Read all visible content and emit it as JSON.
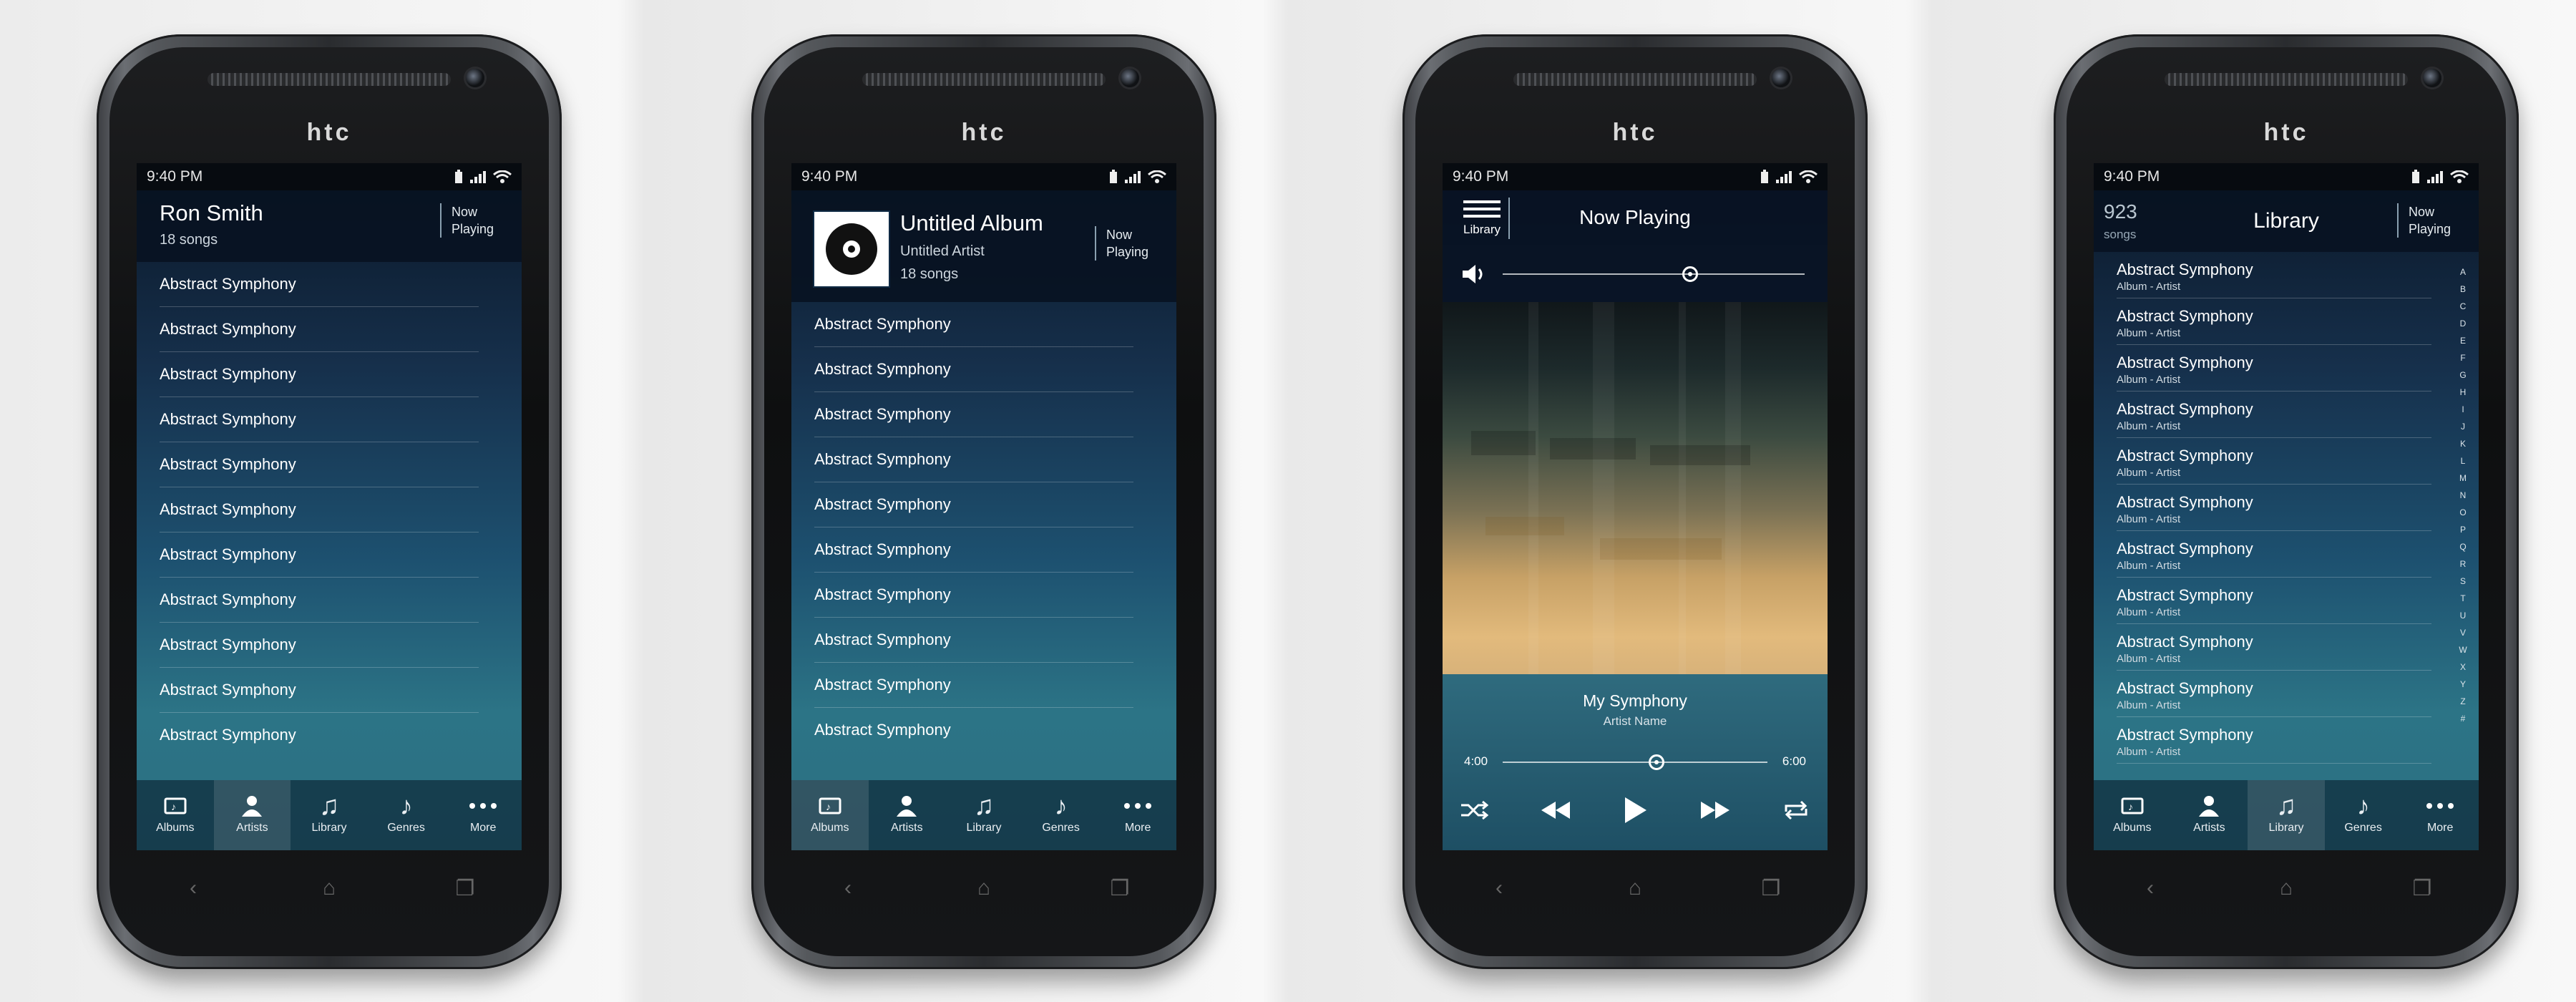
{
  "brand": "htc",
  "status_time": "9:40 PM",
  "tabs": [
    "Albums",
    "Artists",
    "Library",
    "Genres",
    "More"
  ],
  "artist_screen": {
    "title": "Ron Smith",
    "subtitle": "18 songs",
    "now_playing": [
      "Now",
      "Playing"
    ],
    "songs": [
      "Abstract Symphony",
      "Abstract Symphony",
      "Abstract Symphony",
      "Abstract Symphony",
      "Abstract Symphony",
      "Abstract Symphony",
      "Abstract Symphony",
      "Abstract Symphony",
      "Abstract Symphony",
      "Abstract Symphony",
      "Abstract Symphony"
    ],
    "active_tab": "Artists"
  },
  "album_screen": {
    "title": "Untitled Album",
    "artist": "Untitled Artist",
    "count": "18 songs",
    "now_playing": [
      "Now",
      "Playing"
    ],
    "songs": [
      "Abstract Symphony",
      "Abstract Symphony",
      "Abstract Symphony",
      "Abstract Symphony",
      "Abstract Symphony",
      "Abstract Symphony",
      "Abstract Symphony",
      "Abstract Symphony",
      "Abstract Symphony",
      "Abstract Symphony"
    ],
    "active_tab": "Albums"
  },
  "now_playing_screen": {
    "title": "Now Playing",
    "library_label": "Library",
    "song": "My Symphony",
    "artist": "Artist Name",
    "time_elapsed": "4:00",
    "time_total": "6:00",
    "volume_level": 0.62,
    "progress": 0.58
  },
  "library_screen": {
    "count": "923",
    "count_label": "songs",
    "title": "Library",
    "now_playing": [
      "Now",
      "Playing"
    ],
    "items": [
      {
        "title": "Abstract Symphony",
        "sub": "Album - Artist"
      },
      {
        "title": "Abstract Symphony",
        "sub": "Album - Artist"
      },
      {
        "title": "Abstract Symphony",
        "sub": "Album - Artist"
      },
      {
        "title": "Abstract Symphony",
        "sub": "Album - Artist"
      },
      {
        "title": "Abstract Symphony",
        "sub": "Album - Artist"
      },
      {
        "title": "Abstract Symphony",
        "sub": "Album - Artist"
      },
      {
        "title": "Abstract Symphony",
        "sub": "Album - Artist"
      },
      {
        "title": "Abstract Symphony",
        "sub": "Album - Artist"
      },
      {
        "title": "Abstract Symphony",
        "sub": "Album - Artist"
      },
      {
        "title": "Abstract Symphony",
        "sub": "Album - Artist"
      },
      {
        "title": "Abstract Symphony",
        "sub": "Album - Artist"
      }
    ],
    "alphabet": [
      "A",
      "B",
      "C",
      "D",
      "E",
      "F",
      "G",
      "H",
      "I",
      "J",
      "K",
      "L",
      "M",
      "N",
      "O",
      "P",
      "Q",
      "R",
      "S",
      "T",
      "U",
      "V",
      "W",
      "X",
      "Y",
      "Z",
      "#"
    ],
    "active_tab": "Library"
  },
  "colors": {
    "accent": "#ffffff",
    "header_bg": "#081222",
    "screen_bottom": "#2c7486"
  }
}
